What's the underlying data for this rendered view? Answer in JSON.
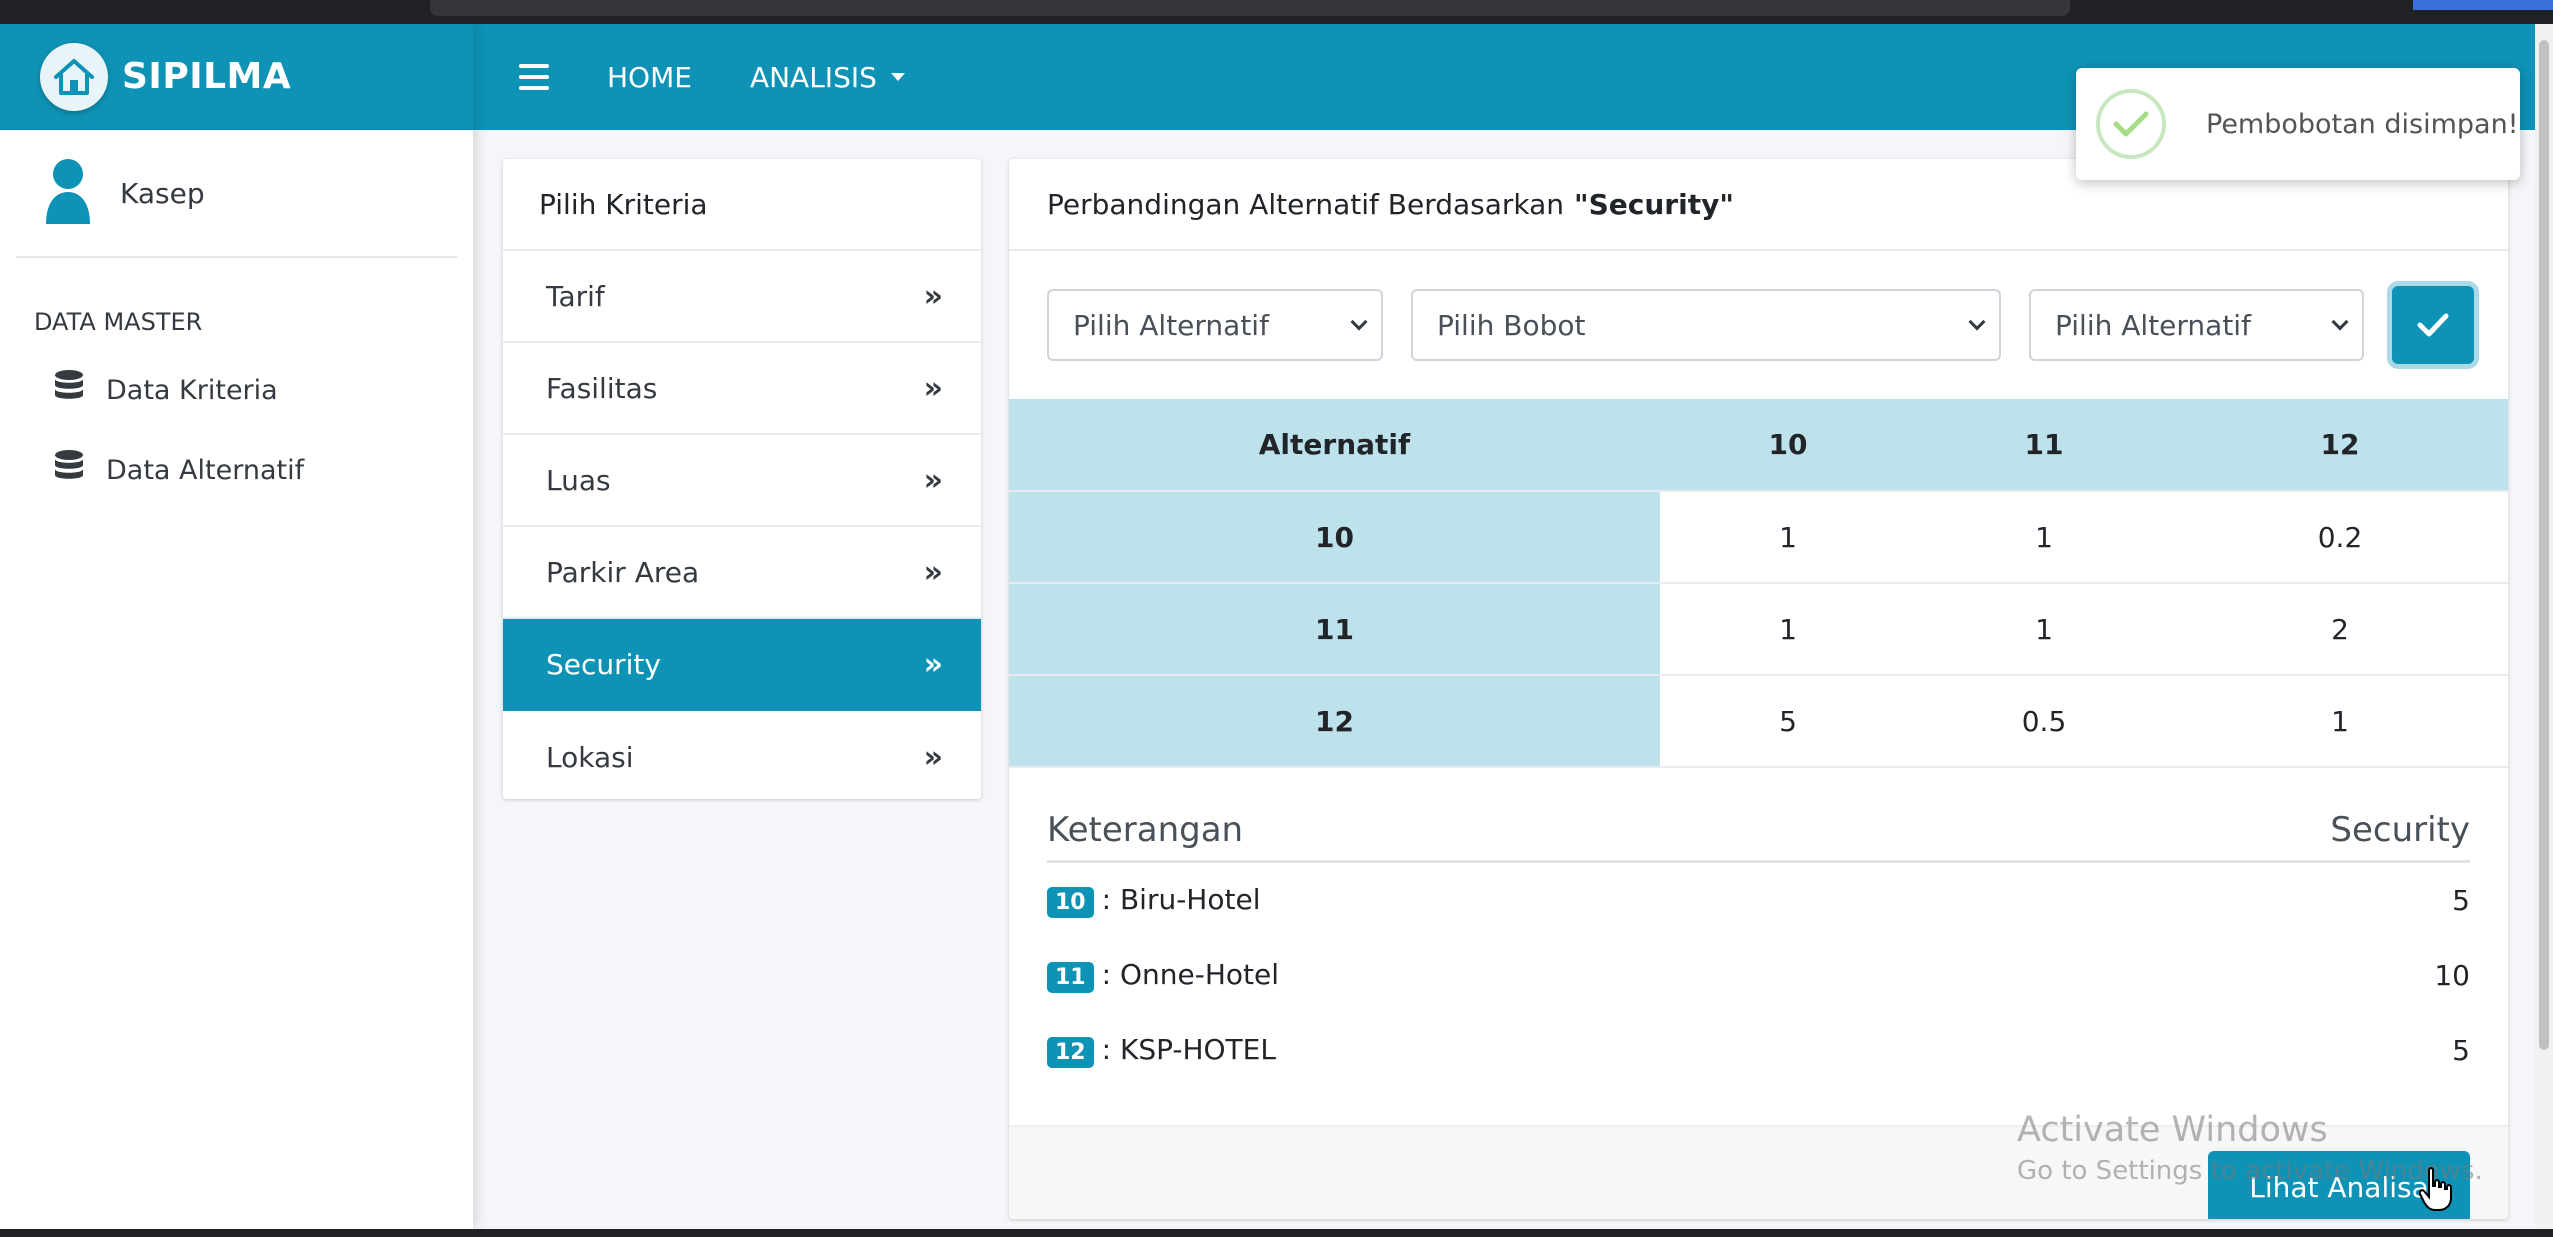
{
  "brand": {
    "title": "SIPILMA"
  },
  "navbar": {
    "home": "HOME",
    "analisis": "ANALISIS"
  },
  "sidebar": {
    "user": "Kasep",
    "section": "DATA MASTER",
    "items": [
      {
        "label": "Data Kriteria",
        "icon": "database-icon"
      },
      {
        "label": "Data Alternatif",
        "icon": "database-icon"
      }
    ]
  },
  "criteria": {
    "header": "Pilih Kriteria",
    "items": [
      "Tarif",
      "Fasilitas",
      "Luas",
      "Parkir Area",
      "Security",
      "Lokasi"
    ],
    "active": "Security",
    "arrow": "»"
  },
  "main": {
    "title_prefix": "Perbandingan Alternatif Berdasarkan",
    "title_criteria": "\"Security\"",
    "select1": "Pilih Alternatif",
    "select2": "Pilih Bobot",
    "select3": "Pilih Alternatif"
  },
  "matrix": {
    "corner": "Alternatif",
    "columns": [
      "10",
      "11",
      "12"
    ],
    "rows": [
      {
        "label": "10",
        "values": [
          "1",
          "1",
          "0.2"
        ]
      },
      {
        "label": "11",
        "values": [
          "1",
          "1",
          "2"
        ]
      },
      {
        "label": "12",
        "values": [
          "5",
          "0.5",
          "1"
        ]
      }
    ]
  },
  "keterangan": {
    "title": "Keterangan",
    "criteria": "Security",
    "rows": [
      {
        "id": "10",
        "name": ": Biru-Hotel",
        "value": "5"
      },
      {
        "id": "11",
        "name": ": Onne-Hotel",
        "value": "10"
      },
      {
        "id": "12",
        "name": ": KSP-HOTEL",
        "value": "5"
      }
    ]
  },
  "footer": {
    "button": "Lihat Analisa"
  },
  "toast": {
    "message": "Pembobotan disimpan!"
  },
  "watermark": {
    "line1": "Activate Windows",
    "line2": "Go to Settings to activate Windows."
  },
  "colors": {
    "primary": "#0e93b6",
    "table_header": "#bde2ec"
  }
}
